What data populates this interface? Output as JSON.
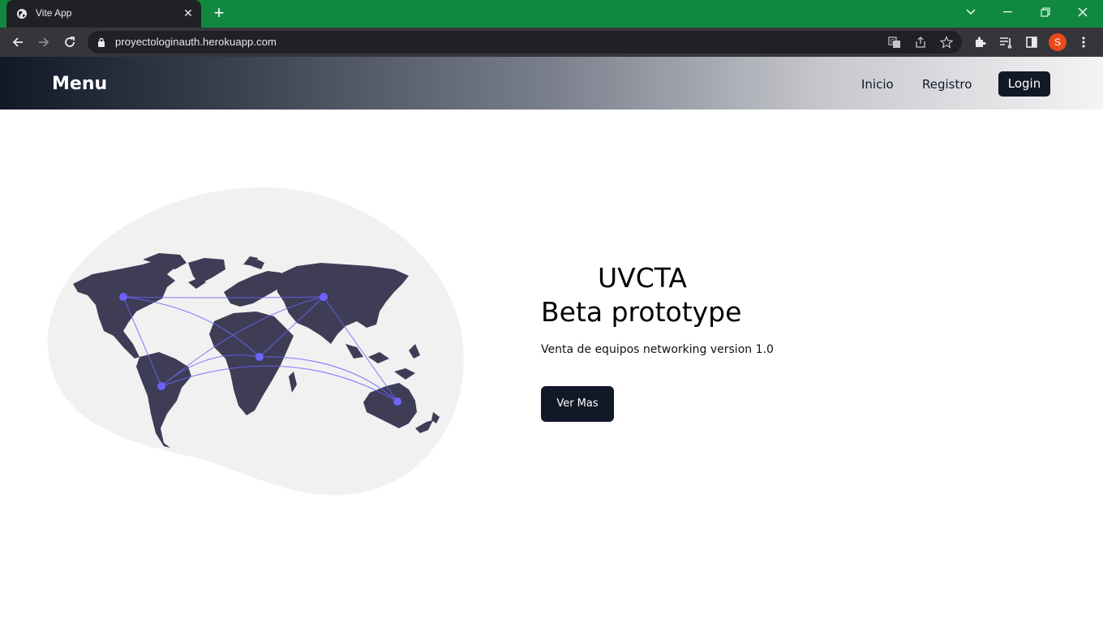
{
  "browser": {
    "tab_title": "Vite App",
    "url": "proyectologinauth.herokuapp.com",
    "profile_initial": "S",
    "tabbar_color": "#10893e",
    "avatar_color": "#e8491d"
  },
  "nav": {
    "brand": "Menu",
    "links": [
      "Inicio",
      "Registro"
    ],
    "login_label": "Login"
  },
  "hero": {
    "title_line1": "UVCTA",
    "title_line2": "Beta prototype",
    "subtitle": "Venta de equipos networking version 1.0",
    "cta_label": "Ver Mas",
    "accent_color": "#111827",
    "illustration": "world-map-network-illustration"
  }
}
